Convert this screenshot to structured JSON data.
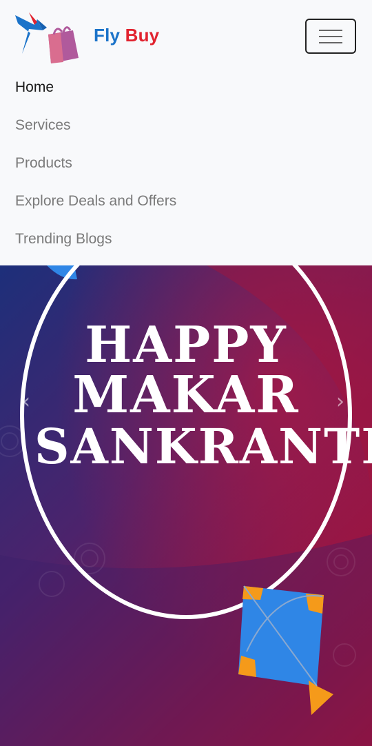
{
  "brand": {
    "word1": "Fly",
    "word2": "Buy"
  },
  "nav": {
    "items": [
      {
        "label": "Home"
      },
      {
        "label": "Services"
      },
      {
        "label": "Products"
      },
      {
        "label": "Explore Deals and Offers"
      },
      {
        "label": "Trending Blogs"
      }
    ],
    "active_index": 0
  },
  "banner": {
    "line1": "HAPPY",
    "line2": "MAKAR",
    "line3": "SANKRANTI",
    "prev_arrow": "‹",
    "next_arrow": "›"
  },
  "colors": {
    "brand_blue": "#1b73c9",
    "brand_red": "#e1232f",
    "banner_start": "#1d2f7a",
    "banner_end": "#b80f2f",
    "kite_blue": "#2f86e6",
    "kite_orange": "#f59a1a"
  },
  "icons": {
    "menu": "hamburger-icon",
    "logo": "bird-shopping-bag-logo",
    "kite": "kite-illustration"
  }
}
